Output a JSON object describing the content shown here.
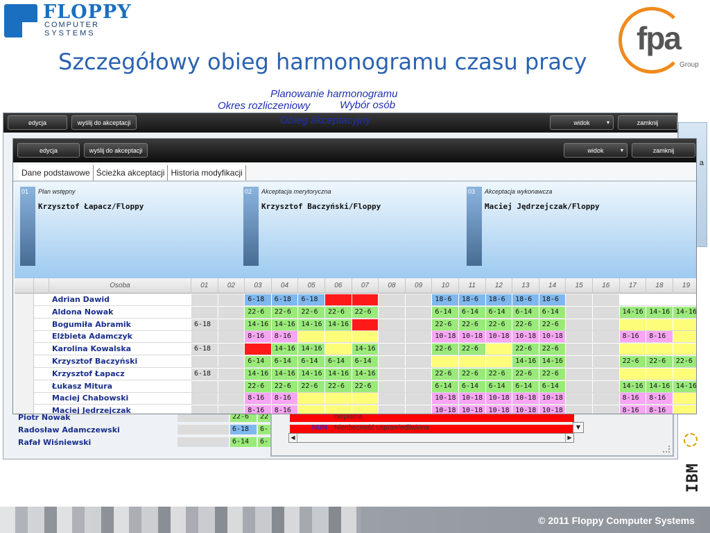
{
  "brand": {
    "floppy_name": "FLOPPY",
    "floppy_line1": "COMPUTER",
    "floppy_line2": "SYSTEMS",
    "fpa_text": "fpa",
    "fpa_sub": "Group"
  },
  "slide_title": "Szczegółowy obieg harmonogramu czasu pracy",
  "floating_labels": {
    "planowanie": "Planowanie harmonogramu",
    "okres": "Okres rozliczeniowy",
    "wybor": "Wybór osób",
    "obieg": "Obieg akceptacyjny"
  },
  "toolbar": {
    "edit_label": "edycja",
    "send_label": "wyślij do akceptacji",
    "view_label": "widok",
    "close_label": "zamknij"
  },
  "bg_right_text": "a",
  "tabs": [
    {
      "label": "Dane podstawowe",
      "active": false
    },
    {
      "label": "Ścieżka akceptacji",
      "active": true
    },
    {
      "label": "Historia modyfikacji",
      "active": false
    }
  ],
  "stages": [
    {
      "num": "01",
      "name": "Plan wstępny",
      "person": "Krzysztof Łapacz/Floppy"
    },
    {
      "num": "02",
      "name": "Akceptacja merytoryczna",
      "person": "Krzysztof Baczyński/Floppy"
    },
    {
      "num": "03",
      "name": "Akceptacja wykonawcza",
      "person": "Maciej Jędrzejczak/Floppy"
    }
  ],
  "grid": {
    "person_header": "Osoba",
    "days": [
      "01",
      "02",
      "03",
      "04",
      "05",
      "06",
      "07",
      "08",
      "09",
      "10",
      "11",
      "12",
      "13",
      "14",
      "15",
      "16",
      "17",
      "18",
      "19"
    ],
    "colors": {
      "blue": "#7fb8ee",
      "green": "#9aea7a",
      "yellow": "#fdfd7a",
      "pink": "#f7a6f3",
      "red": "#ff1a1a",
      "gray": "#dcdcdc"
    },
    "rows": [
      {
        "name": "Adrian Dawid",
        "cells": [
          {
            "c": "gray",
            "t": ""
          },
          {
            "c": "gray",
            "t": ""
          },
          {
            "c": "blue",
            "t": "6-18"
          },
          {
            "c": "blue",
            "t": "6-18"
          },
          {
            "c": "blue",
            "t": "6-18"
          },
          {
            "c": "red",
            "t": ""
          },
          {
            "c": "red",
            "t": ""
          },
          {
            "c": "gray",
            "t": ""
          },
          {
            "c": "gray",
            "t": ""
          },
          {
            "c": "blue",
            "t": "18-6"
          },
          {
            "c": "blue",
            "t": "18-6"
          },
          {
            "c": "blue",
            "t": "18-6"
          },
          {
            "c": "blue",
            "t": "18-6"
          },
          {
            "c": "blue",
            "t": "18-6"
          },
          {
            "c": "gray",
            "t": ""
          },
          {
            "c": "gray",
            "t": ""
          },
          {
            "c": "",
            "t": ""
          },
          {
            "c": "",
            "t": ""
          },
          {
            "c": "",
            "t": ""
          }
        ]
      },
      {
        "name": "Aldona Nowak",
        "cells": [
          {
            "c": "gray",
            "t": ""
          },
          {
            "c": "gray",
            "t": ""
          },
          {
            "c": "green",
            "t": "22-6"
          },
          {
            "c": "green",
            "t": "22-6"
          },
          {
            "c": "green",
            "t": "22-6"
          },
          {
            "c": "green",
            "t": "22-6"
          },
          {
            "c": "green",
            "t": "22-6"
          },
          {
            "c": "gray",
            "t": ""
          },
          {
            "c": "gray",
            "t": ""
          },
          {
            "c": "green",
            "t": "6-14"
          },
          {
            "c": "green",
            "t": "6-14"
          },
          {
            "c": "green",
            "t": "6-14"
          },
          {
            "c": "green",
            "t": "6-14"
          },
          {
            "c": "green",
            "t": "6-14"
          },
          {
            "c": "gray",
            "t": ""
          },
          {
            "c": "gray",
            "t": ""
          },
          {
            "c": "green",
            "t": "14-16"
          },
          {
            "c": "green",
            "t": "14-16"
          },
          {
            "c": "green",
            "t": "14-16"
          }
        ]
      },
      {
        "name": "Bogumiła Abramik",
        "cells": [
          {
            "c": "gray",
            "t": "6-18"
          },
          {
            "c": "gray",
            "t": ""
          },
          {
            "c": "green",
            "t": "14-16"
          },
          {
            "c": "green",
            "t": "14-16"
          },
          {
            "c": "green",
            "t": "14-16"
          },
          {
            "c": "green",
            "t": "14-16"
          },
          {
            "c": "red",
            "t": ""
          },
          {
            "c": "gray",
            "t": ""
          },
          {
            "c": "gray",
            "t": ""
          },
          {
            "c": "green",
            "t": "22-6"
          },
          {
            "c": "green",
            "t": "22-6"
          },
          {
            "c": "green",
            "t": "22-6"
          },
          {
            "c": "green",
            "t": "22-6"
          },
          {
            "c": "green",
            "t": "22-6"
          },
          {
            "c": "gray",
            "t": ""
          },
          {
            "c": "gray",
            "t": ""
          },
          {
            "c": "yellow",
            "t": ""
          },
          {
            "c": "yellow",
            "t": ""
          },
          {
            "c": "yellow",
            "t": ""
          }
        ]
      },
      {
        "name": "Elżbieta Adamczyk",
        "cells": [
          {
            "c": "gray",
            "t": ""
          },
          {
            "c": "gray",
            "t": ""
          },
          {
            "c": "pink",
            "t": "8-16"
          },
          {
            "c": "pink",
            "t": "8-16"
          },
          {
            "c": "yellow",
            "t": ""
          },
          {
            "c": "yellow",
            "t": ""
          },
          {
            "c": "yellow",
            "t": ""
          },
          {
            "c": "gray",
            "t": ""
          },
          {
            "c": "gray",
            "t": ""
          },
          {
            "c": "pink",
            "t": "10-18"
          },
          {
            "c": "pink",
            "t": "10-18"
          },
          {
            "c": "pink",
            "t": "10-18"
          },
          {
            "c": "pink",
            "t": "10-18"
          },
          {
            "c": "pink",
            "t": "10-18"
          },
          {
            "c": "gray",
            "t": ""
          },
          {
            "c": "gray",
            "t": ""
          },
          {
            "c": "pink",
            "t": "8-16"
          },
          {
            "c": "pink",
            "t": "8-16"
          },
          {
            "c": "yellow",
            "t": ""
          }
        ]
      },
      {
        "name": "Karolina Kowalska",
        "cells": [
          {
            "c": "gray",
            "t": "6-18"
          },
          {
            "c": "gray",
            "t": ""
          },
          {
            "c": "red",
            "t": ""
          },
          {
            "c": "green",
            "t": "14-16"
          },
          {
            "c": "green",
            "t": "14-16"
          },
          {
            "c": "yellow",
            "t": ""
          },
          {
            "c": "green",
            "t": "14-16"
          },
          {
            "c": "gray",
            "t": ""
          },
          {
            "c": "gray",
            "t": ""
          },
          {
            "c": "green",
            "t": "22-6"
          },
          {
            "c": "green",
            "t": "22-6"
          },
          {
            "c": "yellow",
            "t": ""
          },
          {
            "c": "green",
            "t": "22-6"
          },
          {
            "c": "green",
            "t": "22-6"
          },
          {
            "c": "gray",
            "t": ""
          },
          {
            "c": "gray",
            "t": ""
          },
          {
            "c": "yellow",
            "t": ""
          },
          {
            "c": "yellow",
            "t": ""
          },
          {
            "c": "yellow",
            "t": ""
          }
        ]
      },
      {
        "name": "Krzysztof Baczyński",
        "cells": [
          {
            "c": "gray",
            "t": ""
          },
          {
            "c": "gray",
            "t": ""
          },
          {
            "c": "green",
            "t": "6-14"
          },
          {
            "c": "green",
            "t": "6-14"
          },
          {
            "c": "green",
            "t": "6-14"
          },
          {
            "c": "green",
            "t": "6-14"
          },
          {
            "c": "green",
            "t": "6-14"
          },
          {
            "c": "gray",
            "t": ""
          },
          {
            "c": "gray",
            "t": ""
          },
          {
            "c": "yellow",
            "t": ""
          },
          {
            "c": "yellow",
            "t": ""
          },
          {
            "c": "yellow",
            "t": ""
          },
          {
            "c": "green",
            "t": "14-16"
          },
          {
            "c": "green",
            "t": "14-16"
          },
          {
            "c": "gray",
            "t": ""
          },
          {
            "c": "gray",
            "t": ""
          },
          {
            "c": "green",
            "t": "22-6"
          },
          {
            "c": "green",
            "t": "22-6"
          },
          {
            "c": "green",
            "t": "22-6"
          }
        ]
      },
      {
        "name": "Krzysztof Łapacz",
        "cells": [
          {
            "c": "gray",
            "t": "6-18"
          },
          {
            "c": "gray",
            "t": ""
          },
          {
            "c": "green",
            "t": "14-16"
          },
          {
            "c": "green",
            "t": "14-16"
          },
          {
            "c": "green",
            "t": "14-16"
          },
          {
            "c": "green",
            "t": "14-16"
          },
          {
            "c": "green",
            "t": "14-16"
          },
          {
            "c": "gray",
            "t": ""
          },
          {
            "c": "gray",
            "t": ""
          },
          {
            "c": "green",
            "t": "22-6"
          },
          {
            "c": "green",
            "t": "22-6"
          },
          {
            "c": "green",
            "t": "22-6"
          },
          {
            "c": "green",
            "t": "22-6"
          },
          {
            "c": "green",
            "t": "22-6"
          },
          {
            "c": "gray",
            "t": ""
          },
          {
            "c": "gray",
            "t": ""
          },
          {
            "c": "yellow",
            "t": ""
          },
          {
            "c": "yellow",
            "t": ""
          },
          {
            "c": "yellow",
            "t": ""
          }
        ]
      },
      {
        "name": "Łukasz Mitura",
        "cells": [
          {
            "c": "gray",
            "t": ""
          },
          {
            "c": "gray",
            "t": ""
          },
          {
            "c": "green",
            "t": "22-6"
          },
          {
            "c": "green",
            "t": "22-6"
          },
          {
            "c": "green",
            "t": "22-6"
          },
          {
            "c": "green",
            "t": "22-6"
          },
          {
            "c": "green",
            "t": "22-6"
          },
          {
            "c": "gray",
            "t": ""
          },
          {
            "c": "gray",
            "t": ""
          },
          {
            "c": "green",
            "t": "6-14"
          },
          {
            "c": "green",
            "t": "6-14"
          },
          {
            "c": "green",
            "t": "6-14"
          },
          {
            "c": "green",
            "t": "6-14"
          },
          {
            "c": "green",
            "t": "6-14"
          },
          {
            "c": "gray",
            "t": ""
          },
          {
            "c": "gray",
            "t": ""
          },
          {
            "c": "green",
            "t": "14-16"
          },
          {
            "c": "green",
            "t": "14-16"
          },
          {
            "c": "green",
            "t": "14-16"
          }
        ]
      },
      {
        "name": "Maciej Chabowski",
        "cells": [
          {
            "c": "gray",
            "t": ""
          },
          {
            "c": "gray",
            "t": ""
          },
          {
            "c": "pink",
            "t": "8-16"
          },
          {
            "c": "pink",
            "t": "8-16"
          },
          {
            "c": "yellow",
            "t": ""
          },
          {
            "c": "yellow",
            "t": ""
          },
          {
            "c": "yellow",
            "t": ""
          },
          {
            "c": "gray",
            "t": ""
          },
          {
            "c": "gray",
            "t": ""
          },
          {
            "c": "pink",
            "t": "10-18"
          },
          {
            "c": "pink",
            "t": "10-18"
          },
          {
            "c": "pink",
            "t": "10-18"
          },
          {
            "c": "pink",
            "t": "10-18"
          },
          {
            "c": "pink",
            "t": "10-18"
          },
          {
            "c": "gray",
            "t": ""
          },
          {
            "c": "gray",
            "t": ""
          },
          {
            "c": "pink",
            "t": "8-16"
          },
          {
            "c": "pink",
            "t": "8-16"
          },
          {
            "c": "yellow",
            "t": ""
          }
        ]
      },
      {
        "name": "Maciej Jędrzejczak",
        "cells": [
          {
            "c": "gray",
            "t": ""
          },
          {
            "c": "gray",
            "t": ""
          },
          {
            "c": "pink",
            "t": "8-16"
          },
          {
            "c": "pink",
            "t": "8-16"
          },
          {
            "c": "yellow",
            "t": ""
          },
          {
            "c": "yellow",
            "t": ""
          },
          {
            "c": "yellow",
            "t": ""
          },
          {
            "c": "gray",
            "t": ""
          },
          {
            "c": "gray",
            "t": ""
          },
          {
            "c": "pink",
            "t": "10-18"
          },
          {
            "c": "pink",
            "t": "10-18"
          },
          {
            "c": "pink",
            "t": "10-18"
          },
          {
            "c": "pink",
            "t": "10-18"
          },
          {
            "c": "pink",
            "t": "10-18"
          },
          {
            "c": "gray",
            "t": ""
          },
          {
            "c": "gray",
            "t": ""
          },
          {
            "c": "pink",
            "t": "8-16"
          },
          {
            "c": "pink",
            "t": "8-16"
          },
          {
            "c": "yellow",
            "t": ""
          }
        ]
      }
    ]
  },
  "bg_rows": [
    {
      "name": "Piotr Nowak",
      "cells": [
        {
          "c": "green",
          "t": "22-6"
        },
        {
          "c": "green",
          "t": "22"
        }
      ]
    },
    {
      "name": "Radosław Adamczewski",
      "cells": [
        {
          "c": "blue",
          "t": "6-18"
        },
        {
          "c": "green",
          "t": "6-"
        }
      ]
    },
    {
      "name": "Rafał Wiśniewski",
      "cells": [
        {
          "c": "green",
          "t": "6-14"
        },
        {
          "c": "green",
          "t": "6-"
        }
      ]
    }
  ],
  "bg_panel": {
    "line1_code": "",
    "line1_text": "niepłatna",
    "line2_code": "NUN",
    "line2_text": "Nieobecność usprawiedliwiona"
  },
  "ibm_text": "IBM",
  "footer_text": "© 2011 Floppy Computer Systems"
}
